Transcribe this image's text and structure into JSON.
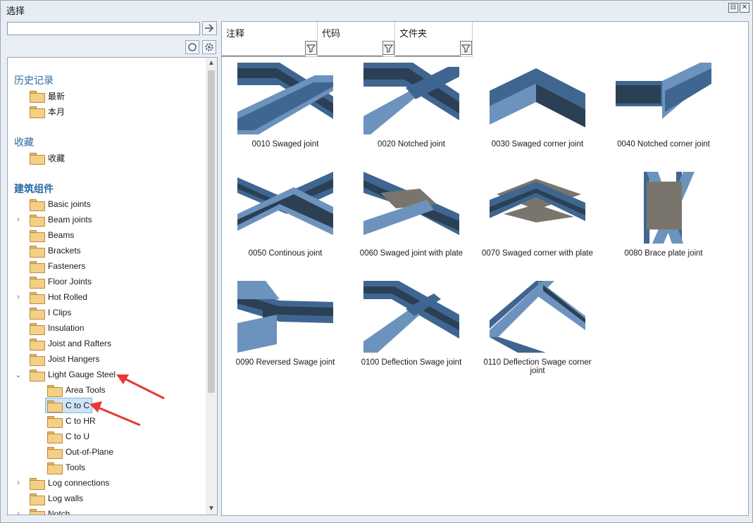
{
  "window": {
    "title": "选择",
    "btn_restore": "⊟",
    "btn_close": "✕"
  },
  "search": {
    "value": "",
    "placeholder": ""
  },
  "tree": {
    "sections": [
      {
        "heading": "历史记录",
        "items": [
          "最新",
          "本月"
        ]
      },
      {
        "heading": "收藏",
        "items": [
          "收藏"
        ]
      },
      {
        "heading": "建筑组件",
        "items": []
      }
    ],
    "components": [
      {
        "label": "Basic joints",
        "expandable": false
      },
      {
        "label": "Beam joints",
        "expandable": true
      },
      {
        "label": "Beams",
        "expandable": false
      },
      {
        "label": "Brackets",
        "expandable": false
      },
      {
        "label": "Fasteners",
        "expandable": false
      },
      {
        "label": "Floor Joints",
        "expandable": false
      },
      {
        "label": "Hot Rolled",
        "expandable": true
      },
      {
        "label": "I Clips",
        "expandable": false
      },
      {
        "label": "Insulation",
        "expandable": false
      },
      {
        "label": "Joist and Rafters",
        "expandable": false
      },
      {
        "label": "Joist Hangers",
        "expandable": false
      },
      {
        "label": "Light Gauge Steel",
        "expandable": true,
        "expanded": true
      }
    ],
    "children": [
      {
        "label": "Area Tools"
      },
      {
        "label": "C to C",
        "selected": true
      },
      {
        "label": "C to HR"
      },
      {
        "label": "C to U"
      },
      {
        "label": "Out-of-Plane"
      },
      {
        "label": "Tools"
      }
    ],
    "after": [
      {
        "label": "Log connections",
        "expandable": true
      },
      {
        "label": "Log walls",
        "expandable": false
      },
      {
        "label": "Notch",
        "expandable": true
      }
    ]
  },
  "filters": [
    {
      "label": "注释"
    },
    {
      "label": "代码"
    },
    {
      "label": "文件夹"
    }
  ],
  "components_grid": [
    {
      "caption": "0010 Swaged joint",
      "variant": "swaged"
    },
    {
      "caption": "0020 Notched joint",
      "variant": "notched"
    },
    {
      "caption": "0030 Swaged corner joint",
      "variant": "corner"
    },
    {
      "caption": "0040 Notched corner joint",
      "variant": "ncorner"
    },
    {
      "caption": "0050 Continous joint",
      "variant": "continous"
    },
    {
      "caption": "0060 Swaged joint with plate",
      "variant": "plate"
    },
    {
      "caption": "0070 Swaged corner with plate",
      "variant": "cornerplate"
    },
    {
      "caption": "0080 Brace plate joint",
      "variant": "brace"
    },
    {
      "caption": "0090 Reversed Swage joint",
      "variant": "reversed"
    },
    {
      "caption": "0100 Deflection Swage joint",
      "variant": "deflection"
    },
    {
      "caption": "0110 Deflection Swage corner joint",
      "variant": "defcorner"
    }
  ],
  "colors": {
    "steel_dark": "#2b3f55",
    "steel_mid": "#3f6690",
    "steel_light": "#6c93bd",
    "plate": "#7a756c",
    "annotation": "#e53935",
    "heading": "#2a6aa6"
  }
}
